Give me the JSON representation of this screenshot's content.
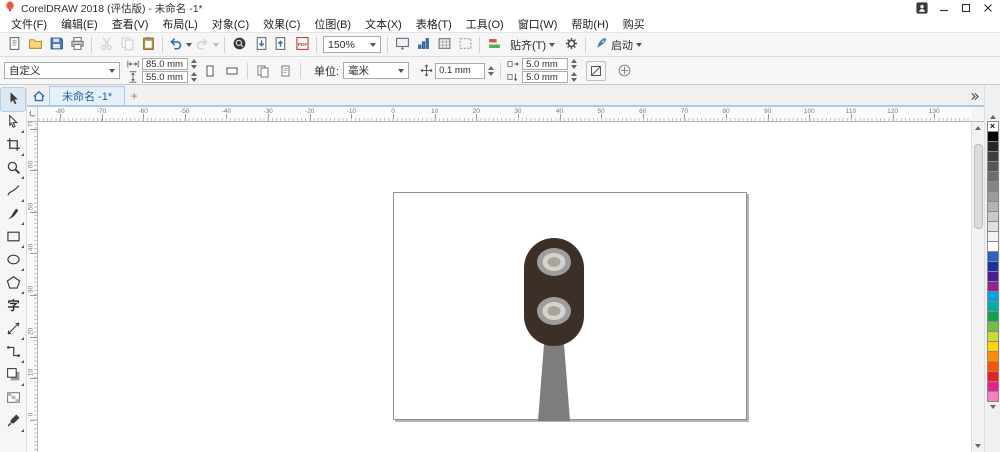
{
  "titlebar": {
    "title": "CorelDRAW 2018 (评估版) - 未命名 -1*"
  },
  "menubar": {
    "items": [
      "文件(F)",
      "编辑(E)",
      "查看(V)",
      "布局(L)",
      "对象(C)",
      "效果(C)",
      "位图(B)",
      "文本(X)",
      "表格(T)",
      "工具(O)",
      "窗口(W)",
      "帮助(H)",
      "购买"
    ]
  },
  "standard_toolbar": {
    "zoom_level": "150%",
    "snap_label": "贴齐(T)",
    "launch_label": "启动",
    "items": [
      {
        "type": "button",
        "icon": "new",
        "name": "new-document-button"
      },
      {
        "type": "button",
        "icon": "open",
        "name": "open-button"
      },
      {
        "type": "button",
        "icon": "save",
        "name": "save-button"
      },
      {
        "type": "button",
        "icon": "print",
        "name": "print-button"
      },
      {
        "type": "sep"
      },
      {
        "type": "button",
        "icon": "cut",
        "name": "cut-button",
        "disabled": true
      },
      {
        "type": "button",
        "icon": "copy",
        "name": "copy-button",
        "disabled": true
      },
      {
        "type": "button",
        "icon": "paste",
        "name": "paste-button"
      },
      {
        "type": "sep"
      },
      {
        "type": "button",
        "icon": "undo",
        "name": "undo-button",
        "dropdown": true
      },
      {
        "type": "button",
        "icon": "redo",
        "name": "redo-button",
        "dropdown": true,
        "disabled": true
      },
      {
        "type": "sep"
      },
      {
        "type": "button",
        "icon": "search",
        "name": "search-content-button"
      },
      {
        "type": "button",
        "icon": "import",
        "name": "import-button"
      },
      {
        "type": "button",
        "icon": "export",
        "name": "export-button"
      },
      {
        "type": "button",
        "icon": "pdf",
        "name": "publish-pdf-button"
      },
      {
        "type": "sep"
      },
      {
        "type": "zoom",
        "name": "zoom-level-combobox"
      },
      {
        "type": "sep"
      },
      {
        "type": "button",
        "icon": "fullscreen",
        "name": "fullscreen-preview-button"
      },
      {
        "type": "button",
        "icon": "levels",
        "name": "show-rulers-button"
      },
      {
        "type": "button",
        "icon": "grid",
        "name": "show-grid-button"
      },
      {
        "type": "button",
        "icon": "dotgrid",
        "name": "show-guidelines-button"
      },
      {
        "type": "sep"
      },
      {
        "type": "button",
        "icon": "align",
        "name": "alignment-guides-button"
      },
      {
        "type": "snap",
        "name": "snap-to-dropdown"
      },
      {
        "type": "button",
        "icon": "gear",
        "name": "options-button"
      },
      {
        "type": "sep"
      },
      {
        "type": "launch",
        "name": "launch-dropdown"
      }
    ]
  },
  "property_bar": {
    "preset": "自定义",
    "page_width": "85.0 mm",
    "page_height": "55.0 mm",
    "units_label": "单位:",
    "units_value": "毫米",
    "nudge": "0.1 mm",
    "dup_x": "5.0 mm",
    "dup_y": "5.0 mm"
  },
  "tabbar": {
    "tab": "未命名 -1*",
    "new_tab": "+"
  },
  "rulers": {
    "h_values": [
      -80,
      -70,
      -60,
      -50,
      -40,
      -30,
      -20,
      -10,
      0,
      10,
      20,
      30,
      40,
      50,
      60,
      70,
      80,
      90,
      100,
      110,
      120,
      130
    ],
    "v_values": [
      70,
      60,
      50,
      40,
      30,
      20,
      10,
      0
    ]
  },
  "toolbox": {
    "tools": [
      {
        "name": "pick-tool",
        "icon": "pick",
        "selected": true
      },
      {
        "name": "shape-tool",
        "icon": "shape",
        "flyout": true
      },
      {
        "name": "crop-tool",
        "icon": "crop",
        "flyout": true
      },
      {
        "name": "zoom-tool",
        "icon": "zoom",
        "flyout": true
      },
      {
        "name": "freehand-tool",
        "icon": "freehand",
        "flyout": true
      },
      {
        "name": "artistic-media-tool",
        "icon": "brush",
        "flyout": true
      },
      {
        "name": "rectangle-tool",
        "icon": "rectangle",
        "flyout": true
      },
      {
        "name": "ellipse-tool",
        "icon": "ellipse",
        "flyout": true
      },
      {
        "name": "polygon-tool",
        "icon": "polygon",
        "flyout": true
      },
      {
        "name": "text-tool",
        "icon": "text"
      },
      {
        "name": "dimension-tool",
        "icon": "dimension",
        "flyout": true
      },
      {
        "name": "connector-tool",
        "icon": "connector",
        "flyout": true
      },
      {
        "name": "drop-shadow-tool",
        "icon": "shadow",
        "flyout": true
      },
      {
        "name": "transparency-tool",
        "icon": "transparency"
      },
      {
        "name": "color-eyedropper-tool",
        "icon": "eyedropper",
        "flyout": true
      }
    ]
  },
  "palette": {
    "colors": [
      "#000000",
      "#282828",
      "#3f3f3f",
      "#565656",
      "#6d6d6d",
      "#848484",
      "#9b9b9b",
      "#b2b2b2",
      "#c9c9c9",
      "#e0e0e0",
      "#f2f2f2",
      "#ffffff",
      "#2e5fc8",
      "#1b2f9e",
      "#4a1f8f",
      "#8f2496",
      "#00a2e8",
      "#00b09a",
      "#13a049",
      "#72bf44",
      "#cbdb2a",
      "#ffd500",
      "#ff8f00",
      "#ff5100",
      "#e32322",
      "#e6218c",
      "#f781bf"
    ]
  },
  "canvas": {
    "drawing": {
      "body_color": "#3b2f27",
      "ring_outer": "#9d9d9d",
      "ring_inner": "#d6d2cc",
      "ring_core": "#aba49c",
      "pole_color": "#7d7d7d"
    }
  }
}
